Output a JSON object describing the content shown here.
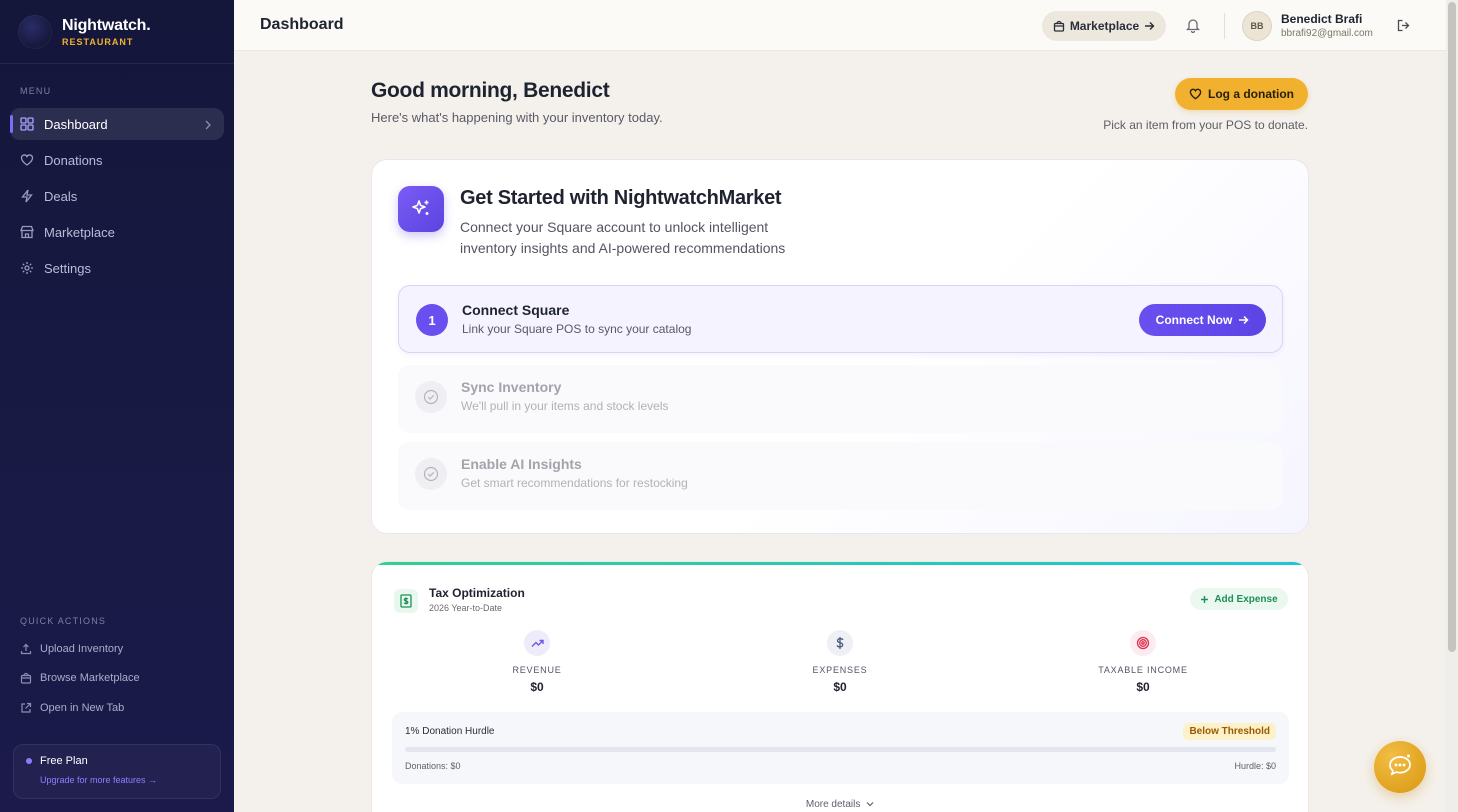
{
  "brand": {
    "name": "Nightwatch.",
    "subtitle": "RESTAURANT"
  },
  "sidebar": {
    "menu_label": "MENU",
    "items": [
      {
        "label": "Dashboard",
        "icon": "grid-icon",
        "active": true
      },
      {
        "label": "Donations",
        "icon": "heart-icon",
        "active": false
      },
      {
        "label": "Deals",
        "icon": "bolt-icon",
        "active": false
      },
      {
        "label": "Marketplace",
        "icon": "store-icon",
        "active": false
      },
      {
        "label": "Settings",
        "icon": "gear-icon",
        "active": false
      }
    ],
    "quick_label": "QUICK ACTIONS",
    "quick_actions": [
      {
        "label": "Upload Inventory",
        "icon": "upload-icon"
      },
      {
        "label": "Browse Marketplace",
        "icon": "bag-icon"
      },
      {
        "label": "Open in New Tab",
        "icon": "external-link-icon"
      }
    ],
    "plan": {
      "name": "Free Plan",
      "link": "Upgrade for more features →"
    }
  },
  "header": {
    "title": "Dashboard",
    "marketplace_button": "Marketplace",
    "user": {
      "initials": "BB",
      "name": "Benedict Brafi",
      "email": "bbrafi92@gmail.com"
    }
  },
  "main": {
    "greeting": "Good morning, Benedict",
    "greeting_sub": "Here's what's happening with your inventory today.",
    "donate_button": "Log a donation",
    "donate_hint": "Pick an item from your POS to donate.",
    "get_started": {
      "title": "Get Started with NightwatchMarket",
      "subtitle": "Connect your Square account to unlock intelligent inventory insights and AI-powered recommendations",
      "steps": [
        {
          "number": "1",
          "title": "Connect Square",
          "desc": "Link your Square POS to sync your catalog",
          "state": "active",
          "button": "Connect Now"
        },
        {
          "title": "Sync Inventory",
          "desc": "We'll pull in your items and stock levels",
          "state": "pending"
        },
        {
          "title": "Enable AI Insights",
          "desc": "Get smart recommendations for restocking",
          "state": "pending"
        }
      ]
    },
    "tax": {
      "title": "Tax Optimization",
      "subtitle": "2026 Year-to-Date",
      "add_expense": "Add Expense",
      "metrics": [
        {
          "label": "REVENUE",
          "value": "$0",
          "icon": "trending-up-icon",
          "color": "#6d5ae6"
        },
        {
          "label": "EXPENSES",
          "value": "$0",
          "icon": "dollar-icon",
          "color": "#4a5a7a"
        },
        {
          "label": "TAXABLE INCOME",
          "value": "$0",
          "icon": "target-icon",
          "color": "#e0304f"
        }
      ],
      "hurdle": {
        "label": "1% Donation Hurdle",
        "badge": "Below Threshold",
        "progress": 0,
        "donations": "Donations: $0",
        "hurdle": "Hurdle: $0"
      },
      "more_details": "More details"
    }
  },
  "colors": {
    "accent": "#6a4ff0",
    "donate": "#f1b12e",
    "sidebar_bg": "#14163a",
    "success": "#2fcf94"
  }
}
